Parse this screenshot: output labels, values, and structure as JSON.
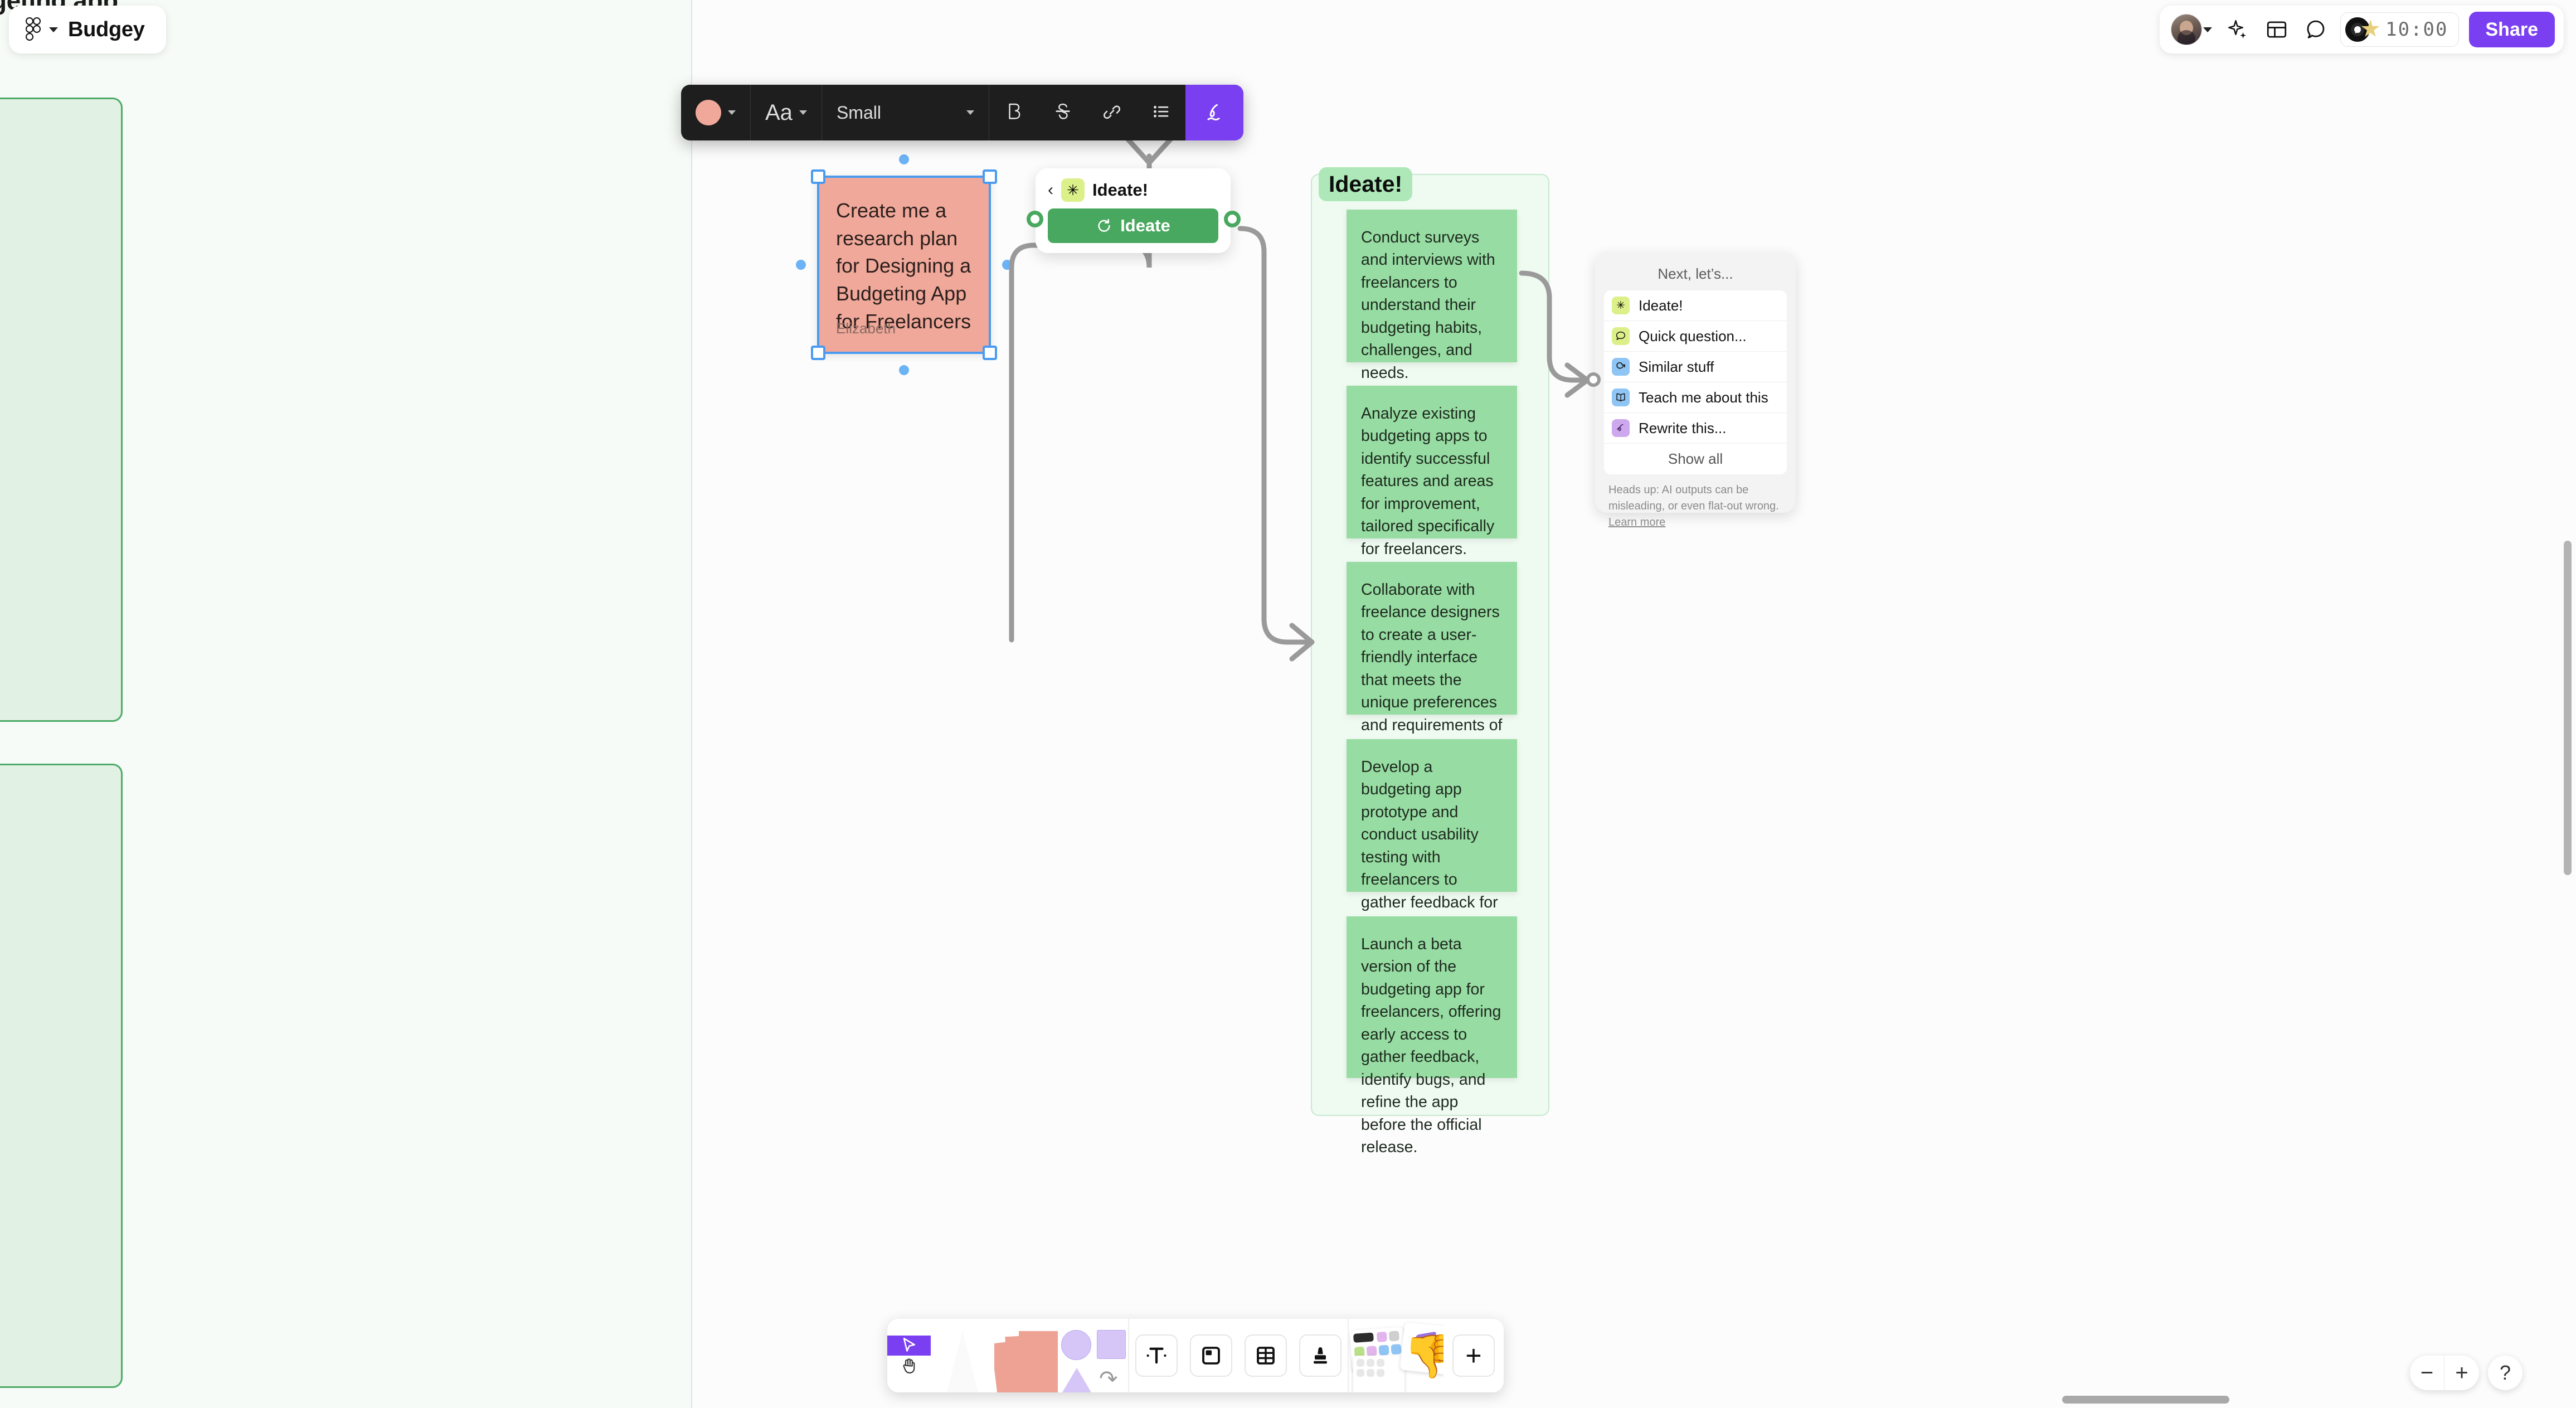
{
  "file": {
    "name": "Budgey",
    "app_icon": "figjam-icon",
    "chevron": "chevron-down-icon"
  },
  "offcanvas": {
    "clipped_text": "geting app"
  },
  "header": {
    "avatar_icon": "avatar",
    "avatar_chevron": "chevron-down-icon",
    "actions": [
      {
        "icon": "sparkle-ai-icon",
        "name": "ai-actions-button"
      },
      {
        "icon": "layout-grid-icon",
        "name": "layout-button"
      },
      {
        "icon": "comment-bubble-icon",
        "name": "comment-button"
      }
    ],
    "timer": {
      "music_icon": "music-vinyl-icon",
      "star_icon": "star-icon",
      "value": "10:00"
    },
    "share_label": "Share"
  },
  "text_toolbar": {
    "color_swatch": "#f0a89a",
    "color_name": "fill-color-swatch",
    "font_label": "Aa",
    "size_value": "Small",
    "bold_label": "B",
    "strikethrough_icon": "strikethrough-icon",
    "link_icon": "link-icon",
    "list_icon": "bulleted-list-icon",
    "ai_pen_icon": "ai-pen-icon",
    "accent_color": "#7b3ff2"
  },
  "sticky_note": {
    "text": "Create me a research plan for Designing a Budgeting App for Freelancers",
    "author": "Elizabeth",
    "fill": "#f0a89a",
    "selection_color": "#4a9bf0"
  },
  "ideate_card": {
    "back_icon": "chevron-left-icon",
    "badge_icon": "sparkle-burst-icon",
    "title": "Ideate!",
    "button_label": "Ideate",
    "button_icon": "refresh-icon",
    "button_color": "#49a85f"
  },
  "ideate_section": {
    "label": "Ideate!",
    "label_bg": "#aee8b8",
    "note_fill": "#97dca2",
    "notes": [
      "Conduct surveys and interviews with freelancers to understand their budgeting habits, challenges, and needs.",
      "Analyze existing budgeting apps to identify successful features and areas for improvement, tailored specifically for freelancers.",
      "Collaborate with freelance designers to create a user-friendly interface that meets the unique preferences and requirements of freelancers.",
      "Develop a budgeting app prototype and conduct usability testing with freelancers to gather feedback for iterative improvements.",
      "Launch a beta version of the budgeting app for freelancers, offering early access to gather feedback, identify bugs, and refine the app before the official release."
    ]
  },
  "next_panel": {
    "title": "Next, let’s...",
    "items": [
      {
        "label": "Ideate!",
        "icon": "sparkle-burst-icon",
        "color": "#dcf08a",
        "glyph": "✳"
      },
      {
        "label": "Quick question...",
        "icon": "speech-bubble-icon",
        "color": "#dcf08a",
        "glyph": "💬"
      },
      {
        "label": "Similar stuff",
        "icon": "similar-swirl-icon",
        "color": "#8fc5f5",
        "glyph": "⟳"
      },
      {
        "label": "Teach me about this",
        "icon": "open-book-icon",
        "color": "#8fc5f5",
        "glyph": "📖"
      },
      {
        "label": "Rewrite this...",
        "icon": "rewrite-squiggle-icon",
        "color": "#cda8ee",
        "glyph": "ɔ"
      }
    ],
    "show_all_label": "Show all",
    "disclaimer": "Heads up: AI outputs can be misleading, or even flat-out wrong.",
    "learn_more_label": "Learn more"
  },
  "bottom_toolbar": {
    "cursor_icon": "cursor-arrow-icon",
    "hand_icon": "hand-pan-icon",
    "pen_icon": "pen-tool-icon",
    "sticky_icon": "sticky-note-tool-icon",
    "shapes_icon": "shapes-tool-icon",
    "text_icon": "text-tool-icon",
    "section_icon": "section-tool-icon",
    "table_icon": "table-tool-icon",
    "stamp_icon": "stamp-tool-icon",
    "widgets_icon": "widgets-tool-icon",
    "more_icon": "plus-icon",
    "active_tool": "cursor",
    "active_color": "#7b3ff2"
  },
  "zoom_controls": {
    "zoom_out_label": "−",
    "zoom_in_label": "+",
    "help_label": "?"
  },
  "scrollbars": {
    "vertical": "vertical-scrollbar",
    "horizontal": "horizontal-scrollbar"
  }
}
